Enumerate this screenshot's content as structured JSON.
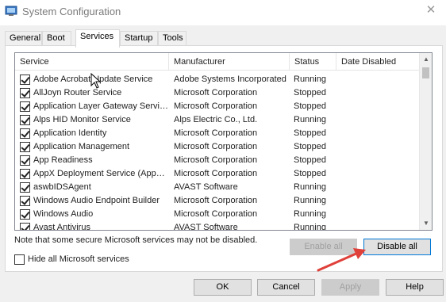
{
  "window": {
    "title": "System Configuration",
    "icon": "msconfig-icon",
    "close_glyph": "✕"
  },
  "tabs": [
    {
      "label": "General",
      "active": false
    },
    {
      "label": "Boot",
      "active": false
    },
    {
      "label": "Services",
      "active": true
    },
    {
      "label": "Startup",
      "active": false
    },
    {
      "label": "Tools",
      "active": false
    }
  ],
  "services": {
    "columns": {
      "service": "Service",
      "manufacturer": "Manufacturer",
      "status": "Status",
      "date_disabled": "Date Disabled"
    },
    "rows": [
      {
        "service": "Adobe Acrobat Update Service",
        "manufacturer": "Adobe Systems Incorporated",
        "status": "Running",
        "date_disabled": "",
        "checked": true
      },
      {
        "service": "AllJoyn Router Service",
        "manufacturer": "Microsoft Corporation",
        "status": "Stopped",
        "date_disabled": "",
        "checked": true
      },
      {
        "service": "Application Layer Gateway Service",
        "manufacturer": "Microsoft Corporation",
        "status": "Stopped",
        "date_disabled": "",
        "checked": true
      },
      {
        "service": "Alps HID Monitor Service",
        "manufacturer": "Alps Electric Co., Ltd.",
        "status": "Running",
        "date_disabled": "",
        "checked": true
      },
      {
        "service": "Application Identity",
        "manufacturer": "Microsoft Corporation",
        "status": "Stopped",
        "date_disabled": "",
        "checked": true
      },
      {
        "service": "Application Management",
        "manufacturer": "Microsoft Corporation",
        "status": "Stopped",
        "date_disabled": "",
        "checked": true
      },
      {
        "service": "App Readiness",
        "manufacturer": "Microsoft Corporation",
        "status": "Stopped",
        "date_disabled": "",
        "checked": true
      },
      {
        "service": "AppX Deployment Service (AppX...",
        "manufacturer": "Microsoft Corporation",
        "status": "Stopped",
        "date_disabled": "",
        "checked": true
      },
      {
        "service": "aswbIDSAgent",
        "manufacturer": "AVAST Software",
        "status": "Running",
        "date_disabled": "",
        "checked": true
      },
      {
        "service": "Windows Audio Endpoint Builder",
        "manufacturer": "Microsoft Corporation",
        "status": "Running",
        "date_disabled": "",
        "checked": true
      },
      {
        "service": "Windows Audio",
        "manufacturer": "Microsoft Corporation",
        "status": "Running",
        "date_disabled": "",
        "checked": true
      },
      {
        "service": "Avast Antivirus",
        "manufacturer": "AVAST Software",
        "status": "Running",
        "date_disabled": "",
        "checked": true
      }
    ]
  },
  "note": "Note that some secure Microsoft services may not be disabled.",
  "buttons": {
    "enable_all": "Enable all",
    "disable_all": "Disable all",
    "ok": "OK",
    "cancel": "Cancel",
    "apply": "Apply",
    "help": "Help"
  },
  "hide_ms": {
    "label": "Hide all Microsoft services",
    "checked": false
  },
  "colors": {
    "annotation_arrow": "#e0403a",
    "selection": "#cce8ff",
    "focus_border": "#0078d7"
  }
}
